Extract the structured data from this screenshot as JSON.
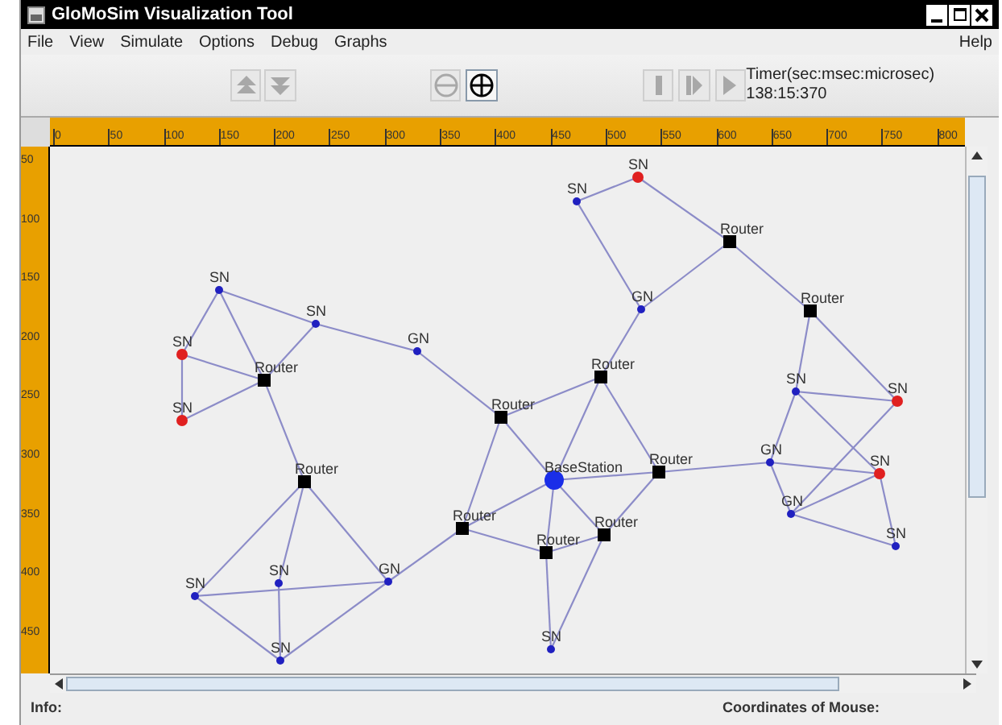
{
  "window": {
    "title": "GloMoSim Visualization Tool"
  },
  "menu": [
    "File",
    "View",
    "Simulate",
    "Options",
    "Debug",
    "Graphs"
  ],
  "help_menu": "Help",
  "toolbar": [
    {
      "kind": "up",
      "disabled": true
    },
    {
      "kind": "down",
      "disabled": true
    },
    {
      "kind": "zoom_out",
      "disabled": true
    },
    {
      "kind": "zoom_in",
      "disabled": false
    },
    {
      "kind": "pause",
      "disabled": true
    },
    {
      "kind": "step",
      "disabled": true
    },
    {
      "kind": "play",
      "disabled": true
    }
  ],
  "timer": {
    "label": "Timer(sec:msec:microsec)",
    "value": "138:15:370"
  },
  "top_ruler": [
    "0",
    "50",
    "100",
    "150",
    "200",
    "250",
    "300",
    "350",
    "400",
    "450",
    "500",
    "550",
    "600",
    "650",
    "700",
    "750",
    "800"
  ],
  "left_ruler": [
    "50",
    "100",
    "150",
    "200",
    "250",
    "300",
    "350",
    "400",
    "450"
  ],
  "nodes": [
    {
      "label": "SN",
      "kind": "sensor",
      "color": "#e02020"
    },
    {
      "label": "SN",
      "kind": "sensor",
      "color": "#2020c0"
    },
    {
      "label": "Router",
      "kind": "router"
    },
    {
      "label": "GN",
      "kind": "sensor",
      "color": "#2020c0"
    },
    {
      "label": "Router",
      "kind": "router"
    },
    {
      "label": "Router",
      "kind": "router"
    },
    {
      "label": "Router",
      "kind": "router"
    },
    {
      "label": "BaseStation",
      "kind": "base"
    },
    {
      "label": "Router",
      "kind": "router"
    },
    {
      "label": "Router",
      "kind": "router"
    },
    {
      "label": "Router",
      "kind": "router"
    },
    {
      "label": "Router",
      "kind": "router"
    },
    {
      "label": "SN",
      "kind": "sensor",
      "color": "#2020c0"
    },
    {
      "label": "SN",
      "kind": "sensor",
      "color": "#2020c0"
    },
    {
      "label": "SN",
      "kind": "sensor",
      "color": "#2020c0"
    },
    {
      "label": "GN",
      "kind": "sensor",
      "color": "#2020c0"
    },
    {
      "label": "SN",
      "kind": "sensor",
      "color": "#e02020"
    },
    {
      "label": "Router",
      "kind": "router"
    },
    {
      "label": "SN",
      "kind": "sensor",
      "color": "#e02020"
    },
    {
      "label": "Router",
      "kind": "router"
    },
    {
      "label": "SN",
      "kind": "sensor",
      "color": "#2020c0"
    },
    {
      "label": "SN",
      "kind": "sensor",
      "color": "#2020c0"
    },
    {
      "label": "GN",
      "kind": "sensor",
      "color": "#2020c0"
    },
    {
      "label": "SN",
      "kind": "sensor",
      "color": "#2020c0"
    },
    {
      "label": "SN",
      "kind": "sensor",
      "color": "#2020c0"
    },
    {
      "label": "SN",
      "kind": "sensor",
      "color": "#e02020"
    },
    {
      "label": "GN",
      "kind": "sensor",
      "color": "#2020c0"
    },
    {
      "label": "SN",
      "kind": "sensor",
      "color": "#e02020"
    },
    {
      "label": "GN",
      "kind": "sensor",
      "color": "#2020c0"
    },
    {
      "label": "SN",
      "kind": "sensor",
      "color": "#2020c0"
    }
  ],
  "status_bar": {
    "info": "Info:",
    "coordinates": "Coordinates of Mouse:"
  }
}
